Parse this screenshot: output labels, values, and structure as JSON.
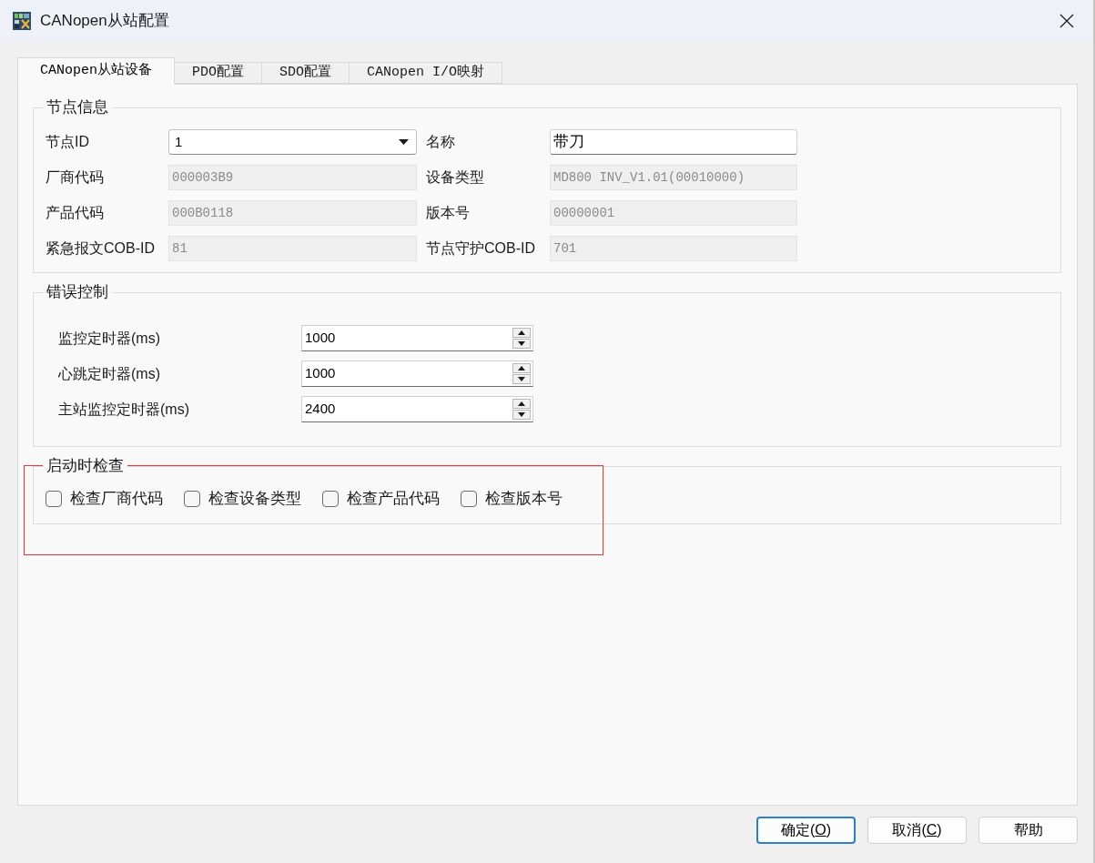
{
  "window": {
    "title": "CANopen从站配置"
  },
  "tabs": [
    {
      "label": "CANopen从站设备",
      "selected": true
    },
    {
      "label": "PDO配置",
      "selected": false
    },
    {
      "label": "SDO配置",
      "selected": false
    },
    {
      "label": "CANopen I/O映射",
      "selected": false
    }
  ],
  "node_info": {
    "title": "节点信息",
    "fields": [
      {
        "label": "节点ID",
        "kind": "dropdown",
        "value": "1",
        "disabled": false
      },
      {
        "label": "名称",
        "kind": "text",
        "value": "带刀",
        "disabled": false
      },
      {
        "label": "厂商代码",
        "kind": "text",
        "value": "000003B9",
        "disabled": true
      },
      {
        "label": "设备类型",
        "kind": "text",
        "value": "MD800 INV_V1.01(00010000)",
        "disabled": true
      },
      {
        "label": "产品代码",
        "kind": "text",
        "value": "000B0118",
        "disabled": true
      },
      {
        "label": "版本号",
        "kind": "text",
        "value": "00000001",
        "disabled": true
      },
      {
        "label": "紧急报文COB-ID",
        "kind": "text",
        "value": "81",
        "disabled": true
      },
      {
        "label": "节点守护COB-ID",
        "kind": "text",
        "value": "701",
        "disabled": true
      }
    ]
  },
  "error_control": {
    "title": "错误控制",
    "timers": [
      {
        "label": "监控定时器(ms)",
        "value": "1000"
      },
      {
        "label": "心跳定时器(ms)",
        "value": "1000"
      },
      {
        "label": "主站监控定时器(ms)",
        "value": "2400"
      }
    ]
  },
  "startup_check": {
    "title": "启动时检查",
    "options": [
      {
        "label": "检查厂商代码",
        "checked": false
      },
      {
        "label": "检查设备类型",
        "checked": false
      },
      {
        "label": "检查产品代码",
        "checked": false
      },
      {
        "label": "检查版本号",
        "checked": false
      }
    ]
  },
  "buttons": [
    {
      "label": "确定(",
      "access_key": "O",
      "label_end": ")",
      "default": true
    },
    {
      "label": "取消(",
      "access_key": "C",
      "label_end": ")",
      "default": false
    },
    {
      "label": "帮助",
      "default": false
    }
  ]
}
